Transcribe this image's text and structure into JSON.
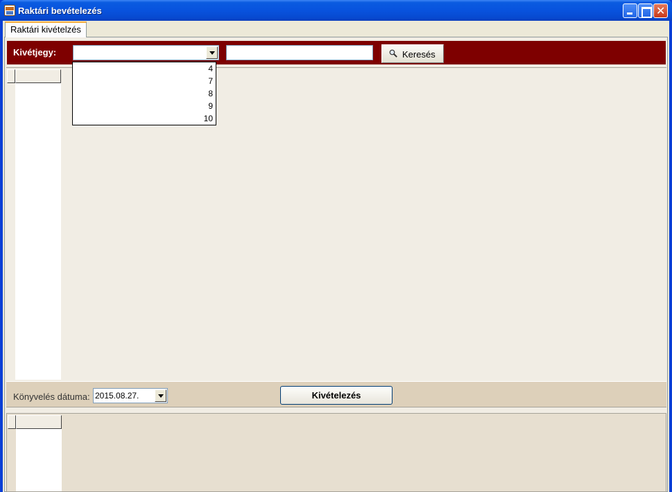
{
  "window": {
    "title": "Raktári bevételezés"
  },
  "tabs": [
    {
      "label": "Raktári kivételzés",
      "active": true
    }
  ],
  "search": {
    "label": "Kivétjegy:",
    "combo_value": "",
    "input_value": "",
    "button_label": "Keresés",
    "dropdown_options": [
      "4",
      "7",
      "8",
      "9",
      "10"
    ]
  },
  "footer": {
    "date_label": "Könyvelés dátuma:",
    "date_value": "2015.08.27.",
    "action_label": "Kivételezés"
  },
  "icons": {
    "app": "app-icon",
    "minimize": "minimize-icon",
    "maximize": "maximize-icon",
    "close": "close-icon",
    "search": "magnifier-icon",
    "dropdown": "chevron-down-icon"
  },
  "colors": {
    "titlebar": "#0853de",
    "search_bar": "#7e0000",
    "panel": "#f1ede4",
    "footer_bar": "#ddd0ba"
  }
}
